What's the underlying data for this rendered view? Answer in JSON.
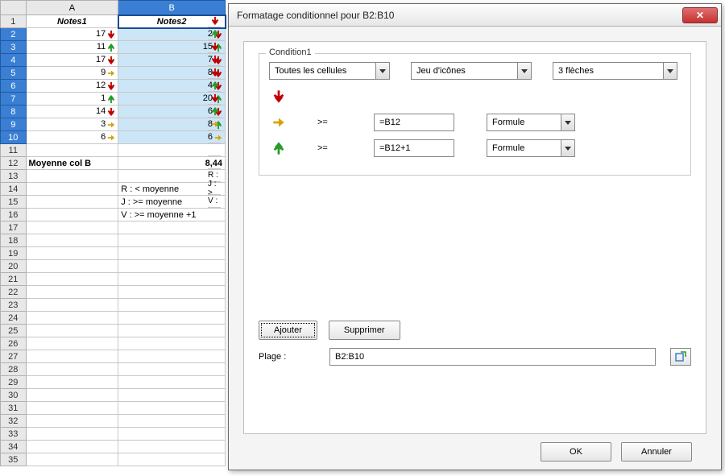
{
  "sheet": {
    "colA": "A",
    "colB": "B",
    "headers": {
      "a": "Notes1",
      "b": "Notes2"
    },
    "rows": [
      {
        "n": "2",
        "a": "17",
        "ai": "down",
        "b": "2",
        "bi": "down",
        "ci": "down"
      },
      {
        "n": "3",
        "a": "11",
        "ai": "up",
        "b": "15",
        "bi": "up",
        "ci": "up"
      },
      {
        "n": "4",
        "a": "17",
        "ai": "down",
        "b": "7",
        "bi": "down",
        "ci": "down"
      },
      {
        "n": "5",
        "a": "9",
        "ai": "right",
        "b": "8",
        "bi": "down",
        "ci": "down"
      },
      {
        "n": "6",
        "a": "12",
        "ai": "down",
        "b": "4",
        "bi": "down",
        "ci": "down"
      },
      {
        "n": "7",
        "a": "1",
        "ai": "up",
        "b": "20",
        "bi": "up",
        "ci": "up"
      },
      {
        "n": "8",
        "a": "14",
        "ai": "down",
        "b": "6",
        "bi": "down",
        "ci": "down"
      },
      {
        "n": "9",
        "a": "3",
        "ai": "right",
        "b": "8",
        "bi": "up",
        "ci": "up"
      },
      {
        "n": "10",
        "a": "6",
        "ai": "right",
        "b": "6",
        "bi": "right",
        "ci": "right"
      }
    ],
    "avglabel": "Moyenne col B",
    "avgval": "8,44",
    "legend": {
      "r": "R : < moyenne",
      "j": "J : >= moyenne",
      "v": "V : >= moyenne +1"
    },
    "legendC": {
      "r": "R :",
      "j": "J : >",
      "v": "V :"
    }
  },
  "dialog": {
    "title": "Formatage conditionnel pour B2:B10",
    "condition_label": "Condition1",
    "combo_all": "Toutes les cellules",
    "combo_iconset": "Jeu d'icônes",
    "combo_3arrows": "3 flèches",
    "op_ge": ">=",
    "val1": "=B12",
    "val2": "=B12+1",
    "formule": "Formule",
    "btn_add": "Ajouter",
    "btn_del": "Supprimer",
    "range_label": "Plage :",
    "range_value": "B2:B10",
    "ok": "OK",
    "cancel": "Annuler"
  }
}
